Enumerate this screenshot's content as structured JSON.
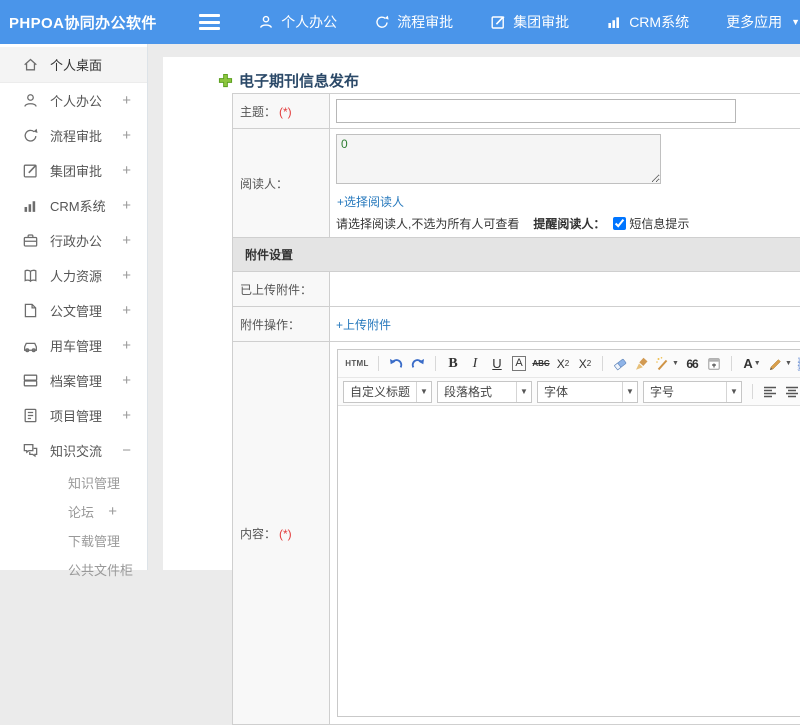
{
  "topbar": {
    "logo": "PHPOA协同办公软件",
    "nav": [
      {
        "label": "个人办公",
        "icon": "person-icon"
      },
      {
        "label": "流程审批",
        "icon": "flow-arrow-icon"
      },
      {
        "label": "集团审批",
        "icon": "edit-square-icon"
      },
      {
        "label": "CRM系统",
        "icon": "bar-chart-icon"
      },
      {
        "label": "更多应用",
        "icon": "caret-down-icon"
      }
    ]
  },
  "sidebar": {
    "items": [
      {
        "label": "个人桌面",
        "icon": "home-icon",
        "expand": "",
        "active": true
      },
      {
        "label": "个人办公",
        "icon": "person-icon",
        "expand": "+"
      },
      {
        "label": "流程审批",
        "icon": "flow-arrow-icon",
        "expand": "+"
      },
      {
        "label": "集团审批",
        "icon": "edit-square-icon",
        "expand": "+"
      },
      {
        "label": "CRM系统",
        "icon": "bar-chart-icon",
        "expand": "+"
      },
      {
        "label": "行政办公",
        "icon": "briefcase-icon",
        "expand": "+"
      },
      {
        "label": "人力资源",
        "icon": "open-book-icon",
        "expand": "+"
      },
      {
        "label": "公文管理",
        "icon": "document-icon",
        "expand": "+"
      },
      {
        "label": "用车管理",
        "icon": "car-icon",
        "expand": "+"
      },
      {
        "label": "档案管理",
        "icon": "archive-icon",
        "expand": "+"
      },
      {
        "label": "项目管理",
        "icon": "clipboard-icon",
        "expand": "+"
      },
      {
        "label": "知识交流",
        "icon": "chat-bubbles-icon",
        "expand": "−"
      }
    ],
    "subitems": [
      {
        "label": "知识管理",
        "expand": ""
      },
      {
        "label": "论坛",
        "expand": "+"
      },
      {
        "label": "下载管理",
        "expand": ""
      },
      {
        "label": "公共文件柜",
        "expand": ""
      }
    ]
  },
  "main": {
    "page_title": "电子期刊信息发布",
    "form": {
      "subject_label": "主题：",
      "required_mark": "(*)",
      "subject_value": "",
      "readers_label": "阅读人：",
      "readers_value": "0",
      "select_readers_link": "+选择阅读人",
      "readers_hint": "请选择阅读人,不选为所有人可查看",
      "remind_label": "提醒阅读人：",
      "sms_checkbox_label": "短信息提示",
      "sms_checked": true,
      "attachment_section_title": "附件设置",
      "uploaded_label": "已上传附件：",
      "attachment_action_label": "附件操作：",
      "upload_link": "+上传附件",
      "content_label": "内容："
    },
    "editor": {
      "buttons": {
        "html": "HTML",
        "bold": "B",
        "italic": "I",
        "underline": "U",
        "font_border": "A",
        "strikethrough": "ABC",
        "sup_base": "X",
        "sup_exp": "2",
        "sub_base": "X",
        "sub_exp": "2",
        "quote": "66",
        "font_color": "A"
      },
      "combos": [
        "自定义标题",
        "段落格式",
        "字体",
        "字号"
      ],
      "toolbar_row1_icons": [
        "html-source",
        "undo",
        "redo",
        "bold",
        "italic",
        "underline",
        "font-border",
        "strikethrough",
        "superscript",
        "subscript",
        "eraser",
        "format-painter",
        "magic-wand",
        "blockquote",
        "date",
        "font-color",
        "highlight-pen",
        "ordered-list",
        "unordered-list"
      ],
      "toolbar_row2_icons": [
        "heading-combo",
        "paragraph-combo",
        "font-family-combo",
        "font-size-combo",
        "align-left",
        "align-center",
        "align-right",
        "align-justify",
        "link",
        "unlink",
        "image",
        "video"
      ]
    }
  },
  "colors": {
    "topbar_blue": "#4a95ea",
    "link_blue": "#2779bd",
    "title_navy": "#2b4968",
    "required_red": "#e23b3b",
    "plus_green": "#8dc63f",
    "section_gray": "#e4e4e4"
  }
}
